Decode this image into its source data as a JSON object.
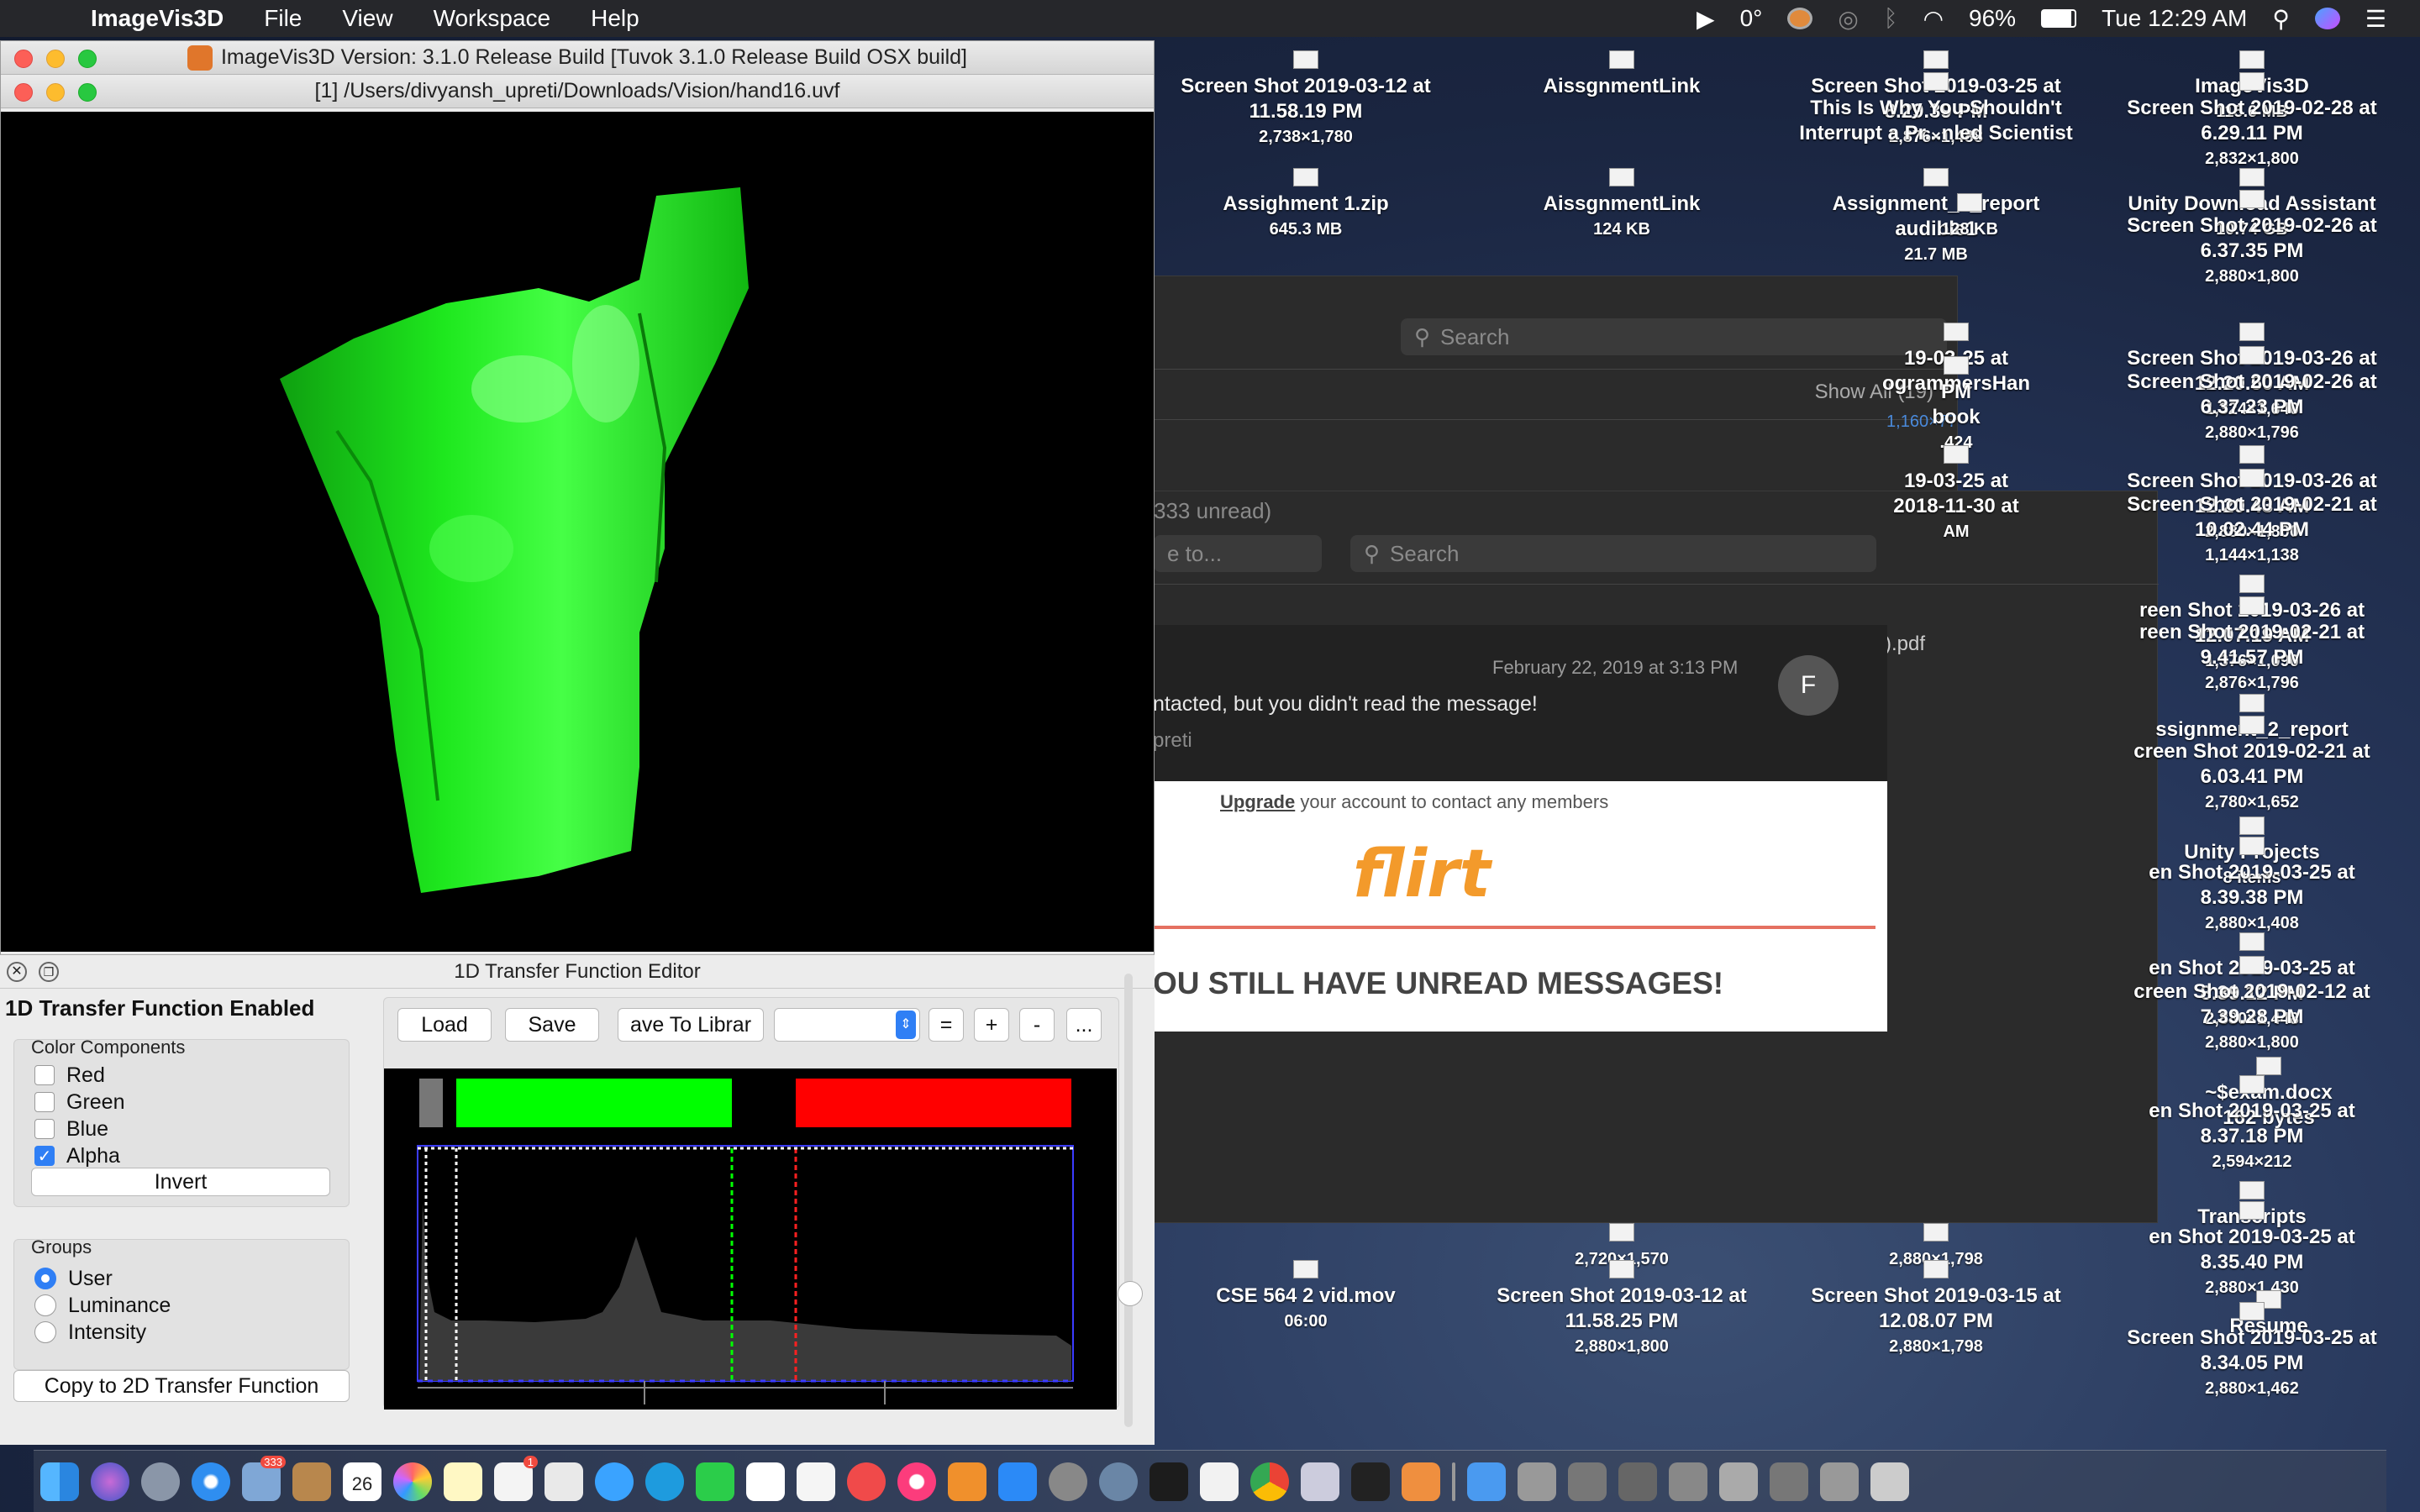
{
  "menubar": {
    "app": "ImageVis3D",
    "items": [
      "File",
      "View",
      "Workspace",
      "Help"
    ],
    "temp": "0°",
    "battery": "96%",
    "clock": "Tue 12:29 AM"
  },
  "main_window": {
    "title": "ImageVis3D Version: 3.1.0 Release Build [Tuvok 3.1.0 Release Build OSX build]",
    "doc_title": "[1] /Users/divyansh_upreti/Downloads/Vision/hand16.uvf"
  },
  "tf_editor": {
    "title": "1D Transfer Function Editor",
    "status": "1D Transfer Function Enabled",
    "color_components_label": "Color Components",
    "components": [
      {
        "label": "Red",
        "checked": false
      },
      {
        "label": "Green",
        "checked": false
      },
      {
        "label": "Blue",
        "checked": false
      },
      {
        "label": "Alpha",
        "checked": true
      }
    ],
    "invert_label": "Invert",
    "groups_label": "Groups",
    "groups": [
      {
        "label": "User",
        "selected": true
      },
      {
        "label": "Luminance",
        "selected": false
      },
      {
        "label": "Intensity",
        "selected": false
      }
    ],
    "copy_label": "Copy to 2D Transfer Function",
    "load_label": "Load",
    "save_label": "Save",
    "save_lib_label": "ave To Librar",
    "eq_label": "=",
    "plus_label": "+",
    "minus_label": "-",
    "more_label": "...",
    "swatch_colors": {
      "green": "#00ff00",
      "red": "#ff0000"
    }
  },
  "bg_windows": {
    "search1": "Search",
    "show_all": "Show All (19)",
    "unread": "333 unread)",
    "search2": "Search",
    "to_field": "e to...",
    "pdf": ").pdf",
    "timestamp": "February 22, 2019 at 3:13 PM",
    "avatar": "F",
    "message": "ntacted, but you didn't read the message!",
    "sender": "preti",
    "upgrade_link": "Upgrade",
    "upgrade_text": " your account to contact any members",
    "logo": "flirt",
    "banner": "OU STILL HAVE UNREAD MESSAGES!",
    "stray": "1,160×77"
  },
  "desktop_icons": [
    {
      "name": "Screen Shot 2019-03-12 at",
      "name2": "11.58.19 PM",
      "sub": "2,738×1,780"
    },
    {
      "name": "AissgnmentLink",
      "name2": "",
      "sub": ""
    },
    {
      "name": "Screen Shot 2019-03-25 at",
      "name2": "8.29.39 PM",
      "sub": "2,876×1,488"
    },
    {
      "name": "This Is Why You Shouldn't",
      "name2": "Interrupt a Pr...nled Scientist",
      "sub": ""
    },
    {
      "name": "ImageVis3D",
      "name2": "",
      "sub": "115.6 MB"
    },
    {
      "name": "Screen Shot 2019-02-28 at",
      "name2": "6.29.11 PM",
      "sub": "2,832×1,800"
    },
    {
      "name": "Assighment 1.zip",
      "name2": "",
      "sub": "645.3 MB"
    },
    {
      "name": "AissgnmentLink",
      "name2": "",
      "sub": "124 KB"
    },
    {
      "name": "Assignment_2_report",
      "name2": "audible1",
      "sub": "21.7 MB"
    },
    {
      "name": "",
      "name2": "",
      "sub": "128 KB"
    },
    {
      "name": "Unity Download Assistant",
      "name2": "",
      "sub": "10.74 GB"
    },
    {
      "name": "Screen Shot 2019-02-26 at",
      "name2": "6.37.35 PM",
      "sub": "2,880×1,800"
    },
    {
      "name": "19-03-25 at",
      "name2": "ogrammersHan",
      "sub": ""
    },
    {
      "name": "PM",
      "name2": "book",
      "sub": ".424"
    },
    {
      "name": "Screen Shot 2019-03-26 at",
      "name2": "12.20.50 AM",
      "sub": "1,324×1,640"
    },
    {
      "name": "Screen Shot 2019-02-26 at",
      "name2": "6.37.23 PM",
      "sub": "2,880×1,796"
    },
    {
      "name": "19-03-25 at",
      "name2": "2018-11-30 at",
      "sub": "AM"
    },
    {
      "name": "Screen Shot 2019-03-26 at",
      "name2": "12.20.43 AM",
      "sub": "2,880×1,800"
    },
    {
      "name": "Screen Shot 2019-02-21 at",
      "name2": "10.02.44 PM",
      "sub": "1,144×1,138"
    },
    {
      "name": "reen Shot 2019-03-26 at",
      "name2": "12.07.19 AM",
      "sub": "1,376×1,090"
    },
    {
      "name": "reen Shot 2019-02-21 at",
      "name2": "9.41.57 PM",
      "sub": "2,876×1,796"
    },
    {
      "name": "ssignment_2_report",
      "name2": "",
      "sub": ""
    },
    {
      "name": "creen Shot 2019-02-21 at",
      "name2": "6.03.41 PM",
      "sub": "2,780×1,652"
    },
    {
      "name": "Unity Projects",
      "name2": "",
      "sub": "8 items"
    },
    {
      "name": "en Shot 2019-03-25 at",
      "name2": "8.39.38 PM",
      "sub": "2,880×1,408"
    },
    {
      "name": "en Shot 2019-03-25 at",
      "name2": "8.39.12 PM",
      "sub": "2,880×1,448"
    },
    {
      "name": "creen Shot 2019-02-12 at",
      "name2": "7.39.28 PM",
      "sub": "2,880×1,800"
    },
    {
      "name": "~$exam.docx",
      "name2": "162 bytes",
      "sub": ""
    },
    {
      "name": "en Shot 2019-03-25 at",
      "name2": "8.37.18 PM",
      "sub": "2,594×212"
    },
    {
      "name": "Transcripts",
      "name2": "",
      "sub": ""
    },
    {
      "name": "en Shot 2019-03-25 at",
      "name2": "8.35.40 PM",
      "sub": "2,880×1,430"
    },
    {
      "name": "Resume",
      "name2": "",
      "sub": ""
    },
    {
      "name": "Screen Shot 2019-03-25 at",
      "name2": "8.34.05 PM",
      "sub": "2,880×1,462"
    },
    {
      "name": "",
      "name2": "",
      "sub": "2,720×1,570"
    },
    {
      "name": "",
      "name2": "",
      "sub": "2,880×1,798"
    },
    {
      "name": "CSE 564 2 vid.mov",
      "name2": "",
      "sub": "06:00"
    },
    {
      "name": "Screen Shot 2019-03-12 at",
      "name2": "11.58.25 PM",
      "sub": "2,880×1,800"
    },
    {
      "name": "Screen Shot 2019-03-15 at",
      "name2": "12.08.07 PM",
      "sub": "2,880×1,798"
    }
  ],
  "dock": {
    "calendar_day": "26",
    "mail_badge": "333",
    "reminders_badge": "1"
  }
}
